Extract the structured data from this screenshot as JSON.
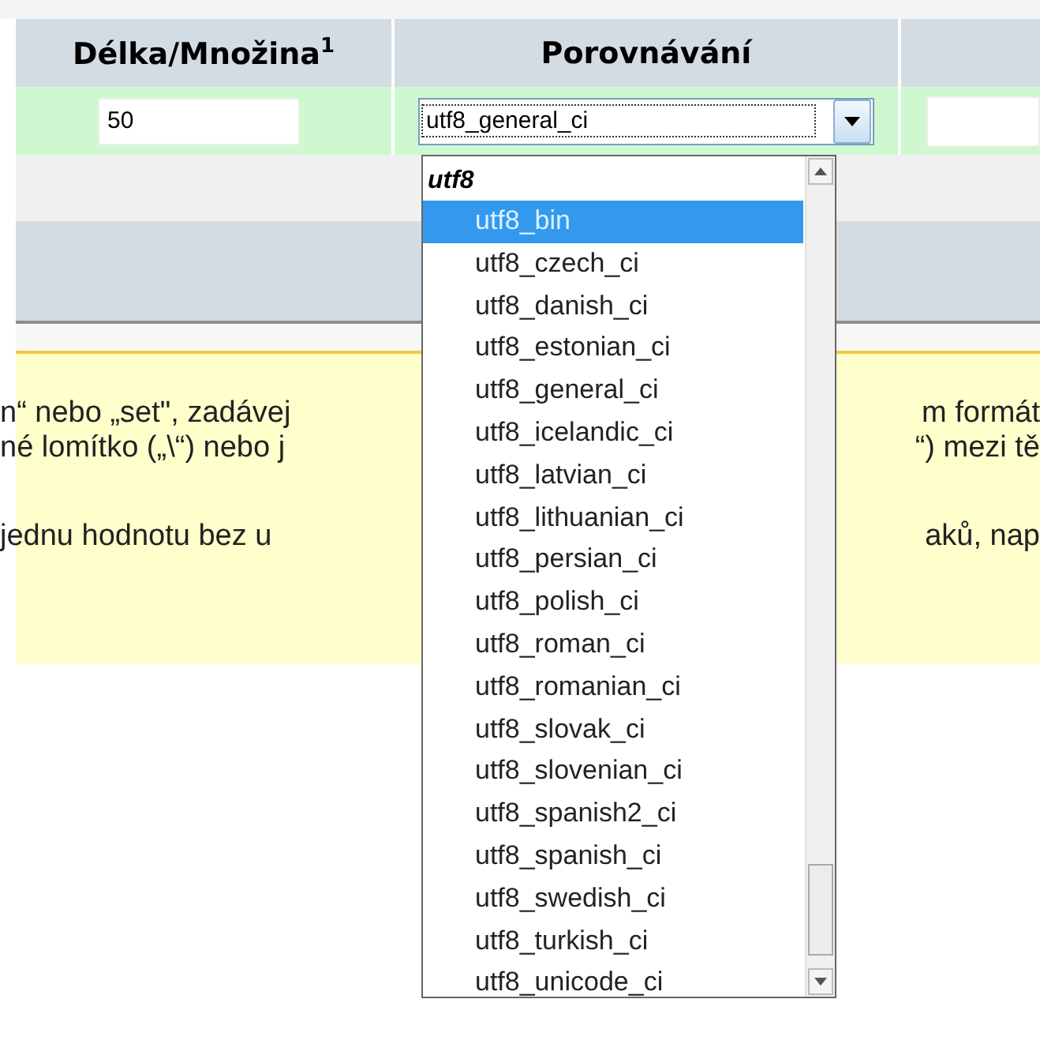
{
  "table": {
    "columns": [
      {
        "label": "Délka/Množina$^{1}$"
      },
      {
        "label": "Porovnávání"
      }
    ],
    "row": {
      "length": "50",
      "collation": "utf8_general_ci"
    }
  },
  "dropdown": {
    "group": "utf8",
    "options": [
      {
        "label": "utf8_bin",
        "selected": true
      },
      {
        "label": "utf8_czech_ci",
        "selected": false
      },
      {
        "label": "utf8_danish_ci",
        "selected": false
      },
      {
        "label": "utf8_estonian_ci",
        "selected": false
      },
      {
        "label": "utf8_general_ci",
        "selected": false
      },
      {
        "label": "utf8_icelandic_ci",
        "selected": false
      },
      {
        "label": "utf8_latvian_ci",
        "selected": false
      },
      {
        "label": "utf8_lithuanian_ci",
        "selected": false
      },
      {
        "label": "utf8_persian_ci",
        "selected": false
      },
      {
        "label": "utf8_polish_ci",
        "selected": false
      },
      {
        "label": "utf8_roman_ci",
        "selected": false
      },
      {
        "label": "utf8_romanian_ci",
        "selected": false
      },
      {
        "label": "utf8_slovak_ci",
        "selected": false
      },
      {
        "label": "utf8_slovenian_ci",
        "selected": false
      },
      {
        "label": "utf8_spanish2_ci",
        "selected": false
      },
      {
        "label": "utf8_spanish_ci",
        "selected": false
      },
      {
        "label": "utf8_swedish_ci",
        "selected": false
      },
      {
        "label": "utf8_turkish_ci",
        "selected": false
      },
      {
        "label": "utf8_unicode_ci",
        "selected": false
      }
    ]
  },
  "note": {
    "lines": [
      {
        "left": "n“ nebo „set\", zadávej",
        "right": "m formát"
      },
      {
        "left": "né lomítko („\\“) nebo j",
        "right": "“) mezi tě"
      },
      {
        "left": "jednu hodnotu bez u",
        "right": "aků, nap"
      }
    ]
  }
}
